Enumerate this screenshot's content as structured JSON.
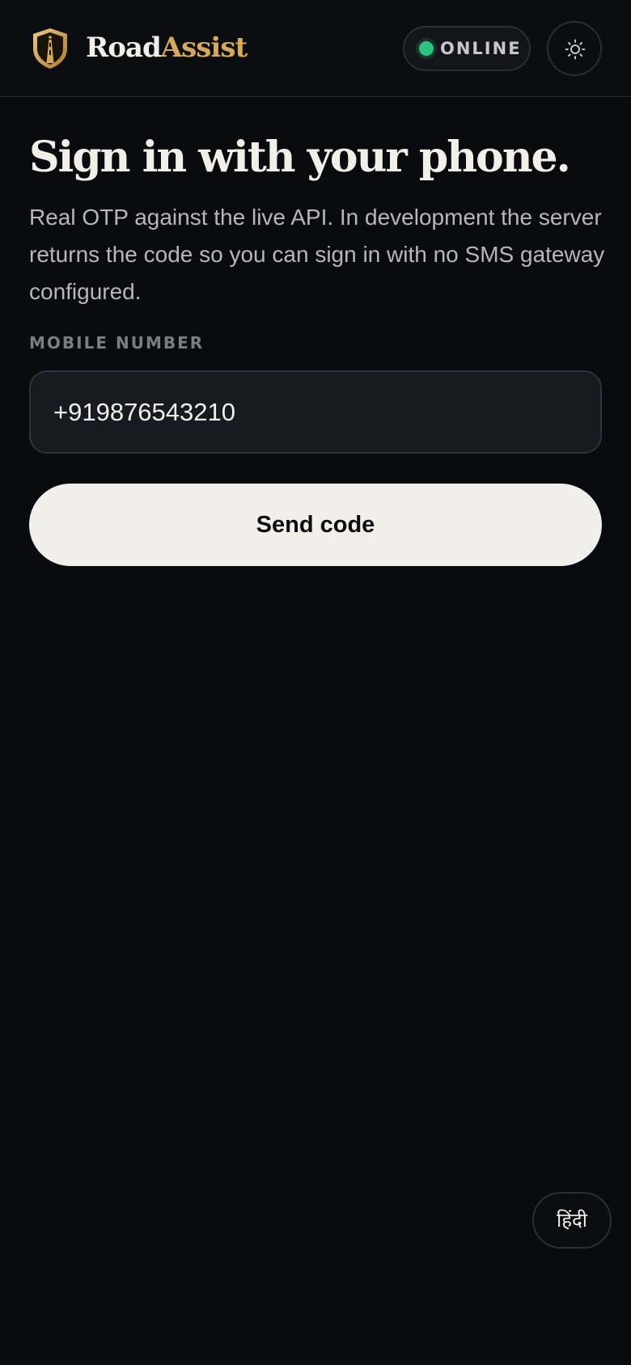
{
  "header": {
    "brand_part1": "Road",
    "brand_part2": "Assist",
    "status": "ONLINE",
    "logo_icon": "shield-road-icon",
    "theme_icon": "sun-icon"
  },
  "main": {
    "title": "Sign in with your phone.",
    "description": "Real OTP against the live API. In development the server returns the code so you can sign in with no SMS gateway configured.",
    "phone_label": "MOBILE NUMBER",
    "phone_value": "+919876543210",
    "send_button": "Send code"
  },
  "language_toggle": "हिंदी",
  "colors": {
    "background": "#0a0b0e",
    "accent_gold": "#d6a85e",
    "status_green": "#2fc17f",
    "button_bg": "#f1efe9"
  }
}
